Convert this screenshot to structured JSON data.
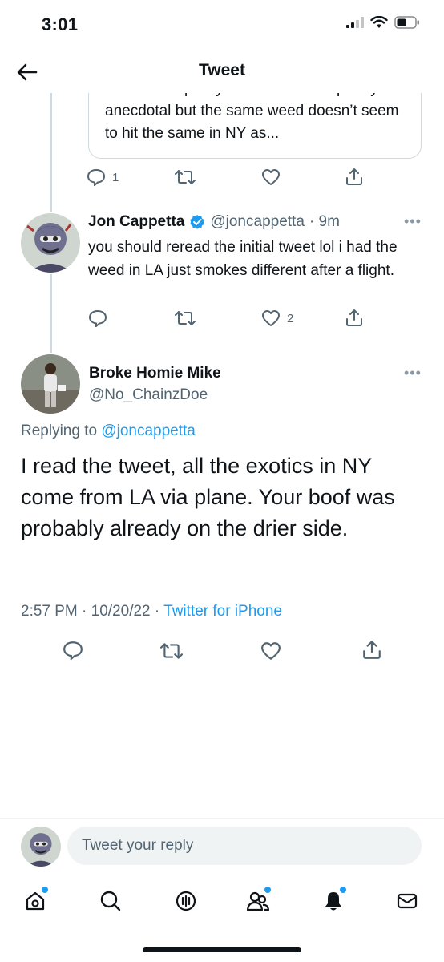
{
  "status_bar": {
    "time": "3:01"
  },
  "header": {
    "title": "Tweet"
  },
  "quoted_tweet": {
    "text_partial": "effects the quality of weed? this is purely anecdotal but the same weed doesn’t seem to hit the same in NY as..."
  },
  "parent_actions": {
    "reply_count": "1",
    "retweet_count": "",
    "like_count": ""
  },
  "reply": {
    "name": "Jon Cappetta",
    "handle": "@joncappetta",
    "time": "· 9m",
    "text": "you should reread the initial tweet lol i had the weed in LA just smokes different after a flight.",
    "reply_count": "",
    "retweet_count": "",
    "like_count": "2"
  },
  "main_tweet": {
    "name": "Broke Homie Mike",
    "handle": "@No_ChainzDoe",
    "replying_prefix": "Replying to",
    "replying_to": "@joncappetta",
    "text": "I read the tweet, all the exotics in NY come from LA via plane. Your boof was probably already on the drier side.",
    "time": "2:57 PM",
    "date": "· 10/20/22 ·",
    "source": "Twitter for iPhone"
  },
  "compose": {
    "placeholder": "Tweet your reply"
  },
  "icons": {
    "back": "arrow-left-icon",
    "reply": "speech-bubble-icon",
    "retweet": "retweet-icon",
    "like": "heart-icon",
    "share": "share-icon",
    "verified": "verified-badge-icon",
    "more": "more-dots-icon",
    "tabs": [
      "home-icon",
      "search-icon",
      "spaces-icon",
      "communities-icon",
      "notifications-icon",
      "messages-icon"
    ]
  },
  "colors": {
    "accent": "#1d9bf0",
    "text": "#0f1419",
    "secondary": "#536471",
    "border": "#cfd9de"
  }
}
